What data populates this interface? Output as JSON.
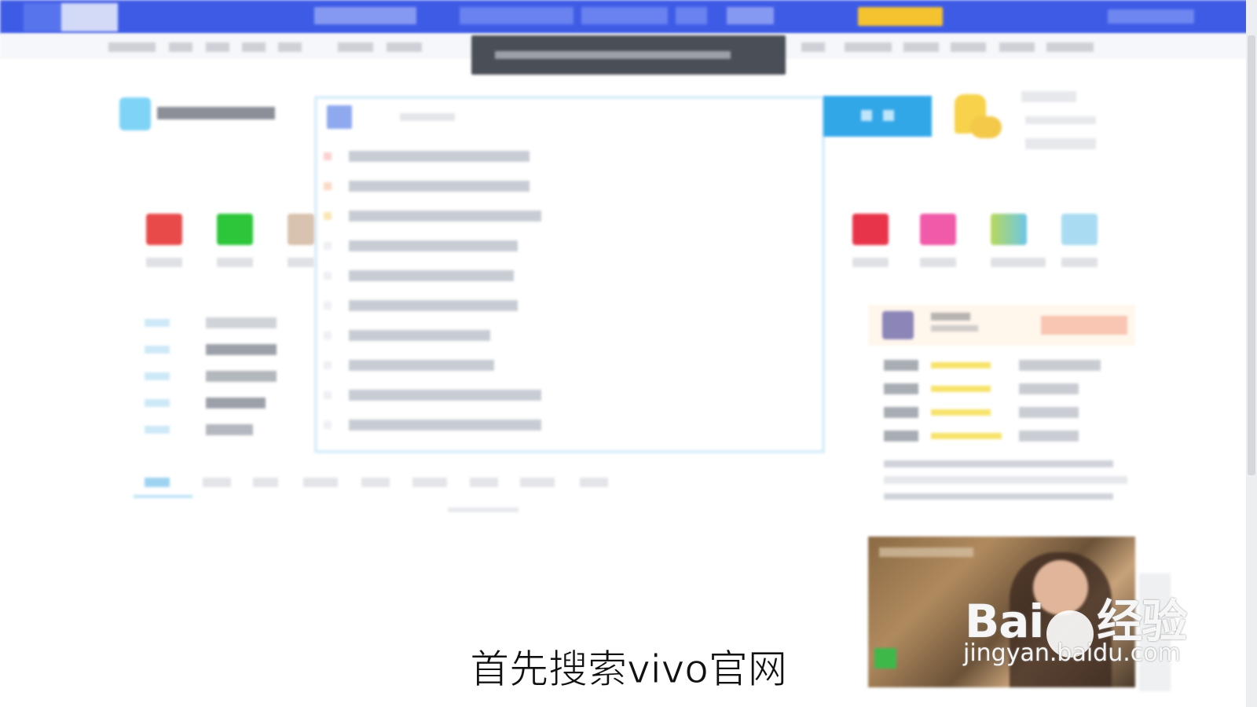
{
  "subtitle": "首先搜索vivo官网",
  "watermark": {
    "brand": "Bai",
    "brand_suffix": "经验",
    "url": "jingyan.baidu.com"
  },
  "colors": {
    "topbar": "#3e5be6",
    "search_button": "#31a7e8",
    "accent_yellow": "#f5c230"
  },
  "icons": [
    "browser-logo-icon",
    "site-logo-icon",
    "search-logo-icon",
    "weather-icon",
    "app-icon",
    "paw-icon"
  ]
}
